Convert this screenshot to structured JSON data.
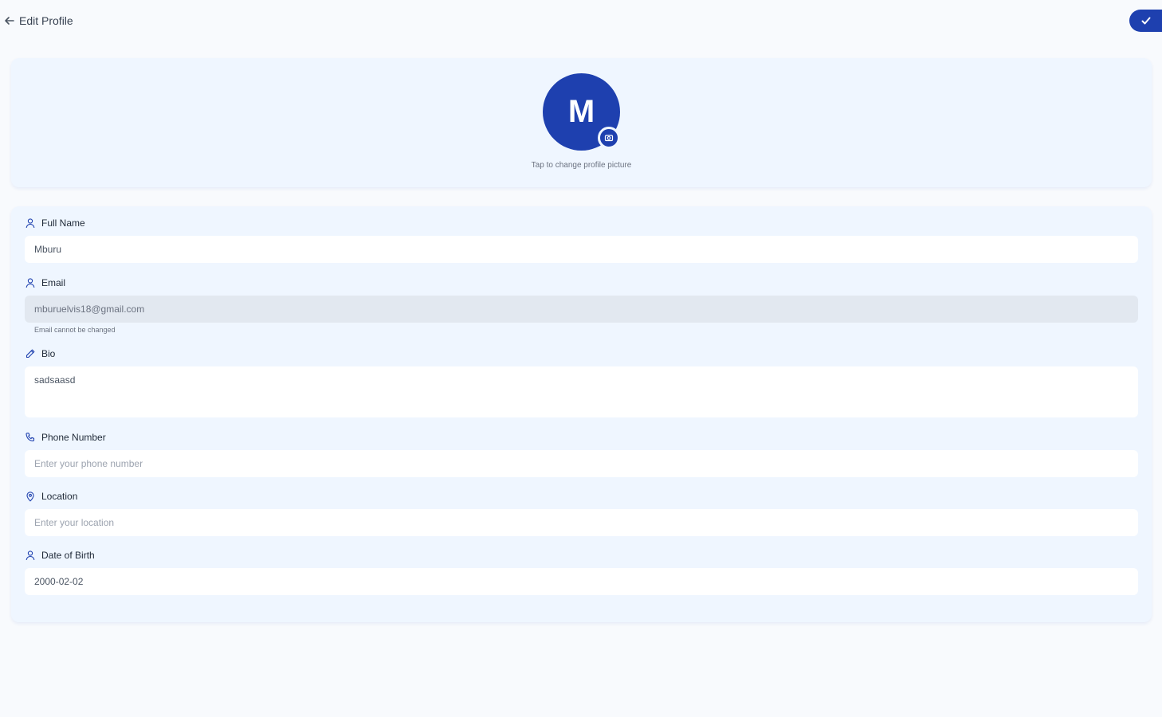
{
  "header": {
    "title": "Edit Profile",
    "back_icon": "arrow-left-icon",
    "save_icon": "check-icon"
  },
  "avatar": {
    "initial": "M",
    "hint": "Tap to change profile picture",
    "badge_icon": "camera-icon"
  },
  "form": {
    "full_name": {
      "label": "Full Name",
      "icon": "user-icon",
      "value": "Mburu"
    },
    "email": {
      "label": "Email",
      "icon": "user-icon",
      "value": "mburuelvis18@gmail.com",
      "helper": "Email cannot be changed"
    },
    "bio": {
      "label": "Bio",
      "icon": "pencil-icon",
      "value": "sadsaasd"
    },
    "phone": {
      "label": "Phone Number",
      "icon": "phone-icon",
      "placeholder": "Enter your phone number"
    },
    "location": {
      "label": "Location",
      "icon": "map-pin-icon",
      "placeholder": "Enter your location"
    },
    "dob": {
      "label": "Date of Birth",
      "icon": "user-icon",
      "value": "2000-02-02"
    }
  },
  "colors": {
    "primary": "#1e40af",
    "card_background": "#eff6ff",
    "page_background": "#f8fafd",
    "disabled_input": "#e2e8f0"
  }
}
